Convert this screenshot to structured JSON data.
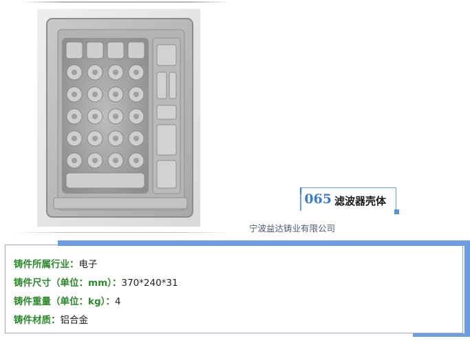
{
  "product": {
    "number": "065",
    "name": "滤波器壳体",
    "company": "宁波益达铸业有限公司"
  },
  "photo": {
    "subject": "aluminum-filter-housing-casting",
    "background_color": "#e9e9e9"
  },
  "specs": [
    {
      "label": "铸件所属行业：",
      "value": "电子"
    },
    {
      "label": "铸件尺寸（单位：mm）：",
      "value": "370*240*31"
    },
    {
      "label": "铸件重量（单位：kg）：",
      "value": "4"
    },
    {
      "label": "铸件材质：",
      "value": "铝合金"
    }
  ],
  "colors": {
    "accent_blue": "#3b7bd6",
    "frame_blue": "#6d9ce3",
    "label_green": "#2a8a2a",
    "label_navy": "#2a4f9a",
    "company_text": "#4a5d7a"
  }
}
